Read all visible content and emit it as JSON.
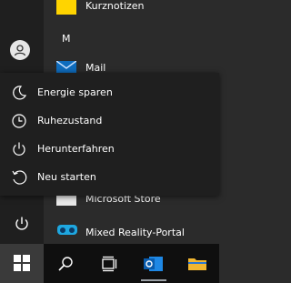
{
  "apps": {
    "kurznotizen": "Kurznotizen",
    "section_letter": "M",
    "mail": "Mail",
    "microsoft_store": "Microsoft Store",
    "mixed_reality": "Mixed Reality-Portal"
  },
  "power_menu": {
    "items": [
      {
        "label": "Energie sparen",
        "icon": "moon-icon"
      },
      {
        "label": "Ruhezustand",
        "icon": "clock-icon"
      },
      {
        "label": "Herunterfahren",
        "icon": "power-icon"
      },
      {
        "label": "Neu starten",
        "icon": "restart-icon"
      }
    ]
  },
  "colors": {
    "menu_bg": "#1f1f1f",
    "list_bg": "#2b2b2b",
    "accent_blue": "#0078d4",
    "sticky_yellow": "#ffd400"
  }
}
